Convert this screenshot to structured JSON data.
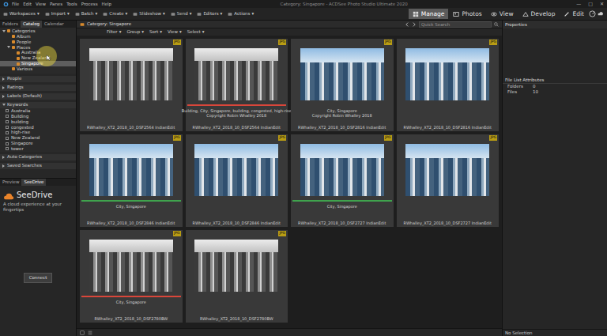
{
  "window": {
    "title": "Category: Singapore - ACDSee Photo Studio Ultimate 2020",
    "controls": [
      "—",
      "□",
      "✕"
    ]
  },
  "menu": [
    "File",
    "Edit",
    "View",
    "Panes",
    "Tools",
    "Process",
    "Help"
  ],
  "dropdown_arrow": "▾",
  "toolbar": [
    "Workspaces",
    "Import",
    "Batch",
    "Create",
    "Slideshow",
    "Send",
    "Editors",
    "Actions"
  ],
  "modes": [
    {
      "label": "Manage",
      "selected": true
    },
    {
      "label": "Photos",
      "selected": false
    },
    {
      "label": "View",
      "selected": false
    },
    {
      "label": "Develop",
      "selected": false
    },
    {
      "label": "Edit",
      "selected": false
    }
  ],
  "left_tabs": [
    {
      "label": "Folders",
      "selected": false
    },
    {
      "label": "Catalog",
      "selected": true
    },
    {
      "label": "Calendar",
      "selected": false
    }
  ],
  "tree": [
    {
      "label": "Categories",
      "expanded": true,
      "selected": false,
      "children": [
        {
          "label": "Album",
          "selected": false
        },
        {
          "label": "People",
          "selected": false
        },
        {
          "label": "Places",
          "expanded": true,
          "selected": false,
          "children": [
            {
              "label": "Australia",
              "selected": false
            },
            {
              "label": "New Zealand",
              "selected": false
            },
            {
              "label": "Singapore",
              "selected": true
            }
          ]
        },
        {
          "label": "Various",
          "selected": false
        }
      ]
    }
  ],
  "sections": [
    {
      "label": "People",
      "expanded": false
    },
    {
      "label": "Ratings",
      "expanded": false
    },
    {
      "label": "Labels (Default)",
      "expanded": false
    },
    {
      "label": "Keywords",
      "expanded": true,
      "items": [
        {
          "label": "Australia",
          "checked": false
        },
        {
          "label": "Building",
          "checked": false
        },
        {
          "label": "building",
          "checked": false
        },
        {
          "label": "congested",
          "checked": false
        },
        {
          "label": "high-rise",
          "checked": false
        },
        {
          "label": "New Zealand",
          "checked": false
        },
        {
          "label": "Singapore",
          "checked": false
        },
        {
          "label": "tower",
          "checked": false
        }
      ]
    },
    {
      "label": "Auto Categories",
      "expanded": false
    },
    {
      "label": "Saved Searches",
      "expanded": false
    }
  ],
  "bottom_tabs": [
    {
      "label": "Preview",
      "selected": false
    },
    {
      "label": "SeeDrive",
      "selected": true
    }
  ],
  "seedrive": {
    "title": "SeeDrive",
    "tagline": "A cloud experience at your fingertips",
    "button": "Connect"
  },
  "browser": {
    "path": "Category: Singapore",
    "search_placeholder": "Quick Search",
    "filters": [
      "Filter",
      "Group",
      "Sort",
      "View",
      "Select"
    ]
  },
  "thumbnails": [
    {
      "filename": "RWhalley_XT2_2018_10_DSF2564 IndianEdit",
      "badge": "JPG",
      "kind": "mono",
      "color": null,
      "caption": []
    },
    {
      "filename": "RWhalley_XT2_2018_10_DSF2564 IndianEdit",
      "badge": "JPG",
      "kind": "mono",
      "color": "#d9463a",
      "caption": [
        "Building, City, Singapore, building, congested, high-rise",
        "Copyright Robin Whalley 2018"
      ]
    },
    {
      "filename": "RWhalley_XT2_2018_10_DSF2816 IndianEdit",
      "badge": "JPG",
      "kind": "color",
      "color": null,
      "caption": [
        "City, Singapore",
        "Copyright Robin Whalley 2018"
      ]
    },
    {
      "filename": "RWhalley_XT2_2018_10_DSF2816 IndianEdit",
      "badge": "JPG",
      "kind": "color",
      "color": null,
      "caption": []
    },
    {
      "filename": "RWhalley_XT2_2018_10_DSF2846 IndianEdit",
      "badge": "JPG",
      "kind": "color",
      "color": "#3fa34d",
      "caption": [
        "City, Singapore"
      ]
    },
    {
      "filename": "RWhalley_XT2_2018_10_DSF2846 IndianEdit",
      "badge": "JPG",
      "kind": "color",
      "color": null,
      "caption": []
    },
    {
      "filename": "RWhalley_XT2_2018_10_DSF2727 IndianEdit",
      "badge": "JPG",
      "kind": "color",
      "color": "#3fa34d",
      "caption": [
        "City, Singapore"
      ]
    },
    {
      "filename": "RWhalley_XT2_2018_10_DSF2727 IndianEdit",
      "badge": "JPG",
      "kind": "color",
      "color": null,
      "caption": []
    },
    {
      "filename": "RWhalley_XT2_2018_10_DSF2780BW",
      "badge": "JPG",
      "kind": "mono",
      "color": "#d9463a",
      "caption": [
        "City, Singapore"
      ]
    },
    {
      "filename": "RWhalley_XT2_2018_10_DSF2780BW",
      "badge": "JPG",
      "kind": "mono",
      "color": null,
      "caption": []
    }
  ],
  "properties": {
    "title": "Properties",
    "section": "File List Attributes",
    "rows": [
      {
        "label": "Folders",
        "value": "0"
      },
      {
        "label": "Files",
        "value": "10"
      }
    ],
    "footer": "No Selection"
  }
}
